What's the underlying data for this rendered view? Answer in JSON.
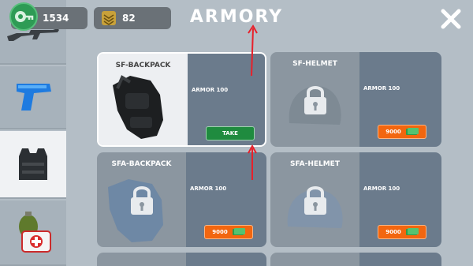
{
  "header": {
    "title": "ARMORY",
    "money": "1534",
    "rank": "82",
    "money_icon": "cash-icon",
    "rank_icon": "chevron-rank-icon",
    "close_icon": "close-icon"
  },
  "sidebar": {
    "tabs": [
      {
        "name": "rifle-tab",
        "icon": "rifle-icon"
      },
      {
        "name": "pistol-tab",
        "icon": "pistol-icon"
      },
      {
        "name": "armor-tab",
        "icon": "vest-icon",
        "active": true
      },
      {
        "name": "supplies-tab",
        "icon": "grenade-medkit-icon"
      }
    ]
  },
  "items": [
    {
      "name": "SF-BACKPACK",
      "armor": "ARMOR 100",
      "action": "TAKE",
      "locked": false,
      "selected": true
    },
    {
      "name": "SF-HELMET",
      "armor": "ARMOR 100",
      "price": "9000",
      "locked": true
    },
    {
      "name": "SFA-BACKPACK",
      "armor": "ARMOR 100",
      "price": "9000",
      "locked": true
    },
    {
      "name": "SFA-HELMET",
      "armor": "ARMOR 100",
      "price": "9000",
      "locked": true
    }
  ],
  "colors": {
    "background": "#b4bec6",
    "take_button": "#1f8b3f",
    "buy_button": "#f2660f",
    "annotation_arrow": "#e8202a"
  }
}
